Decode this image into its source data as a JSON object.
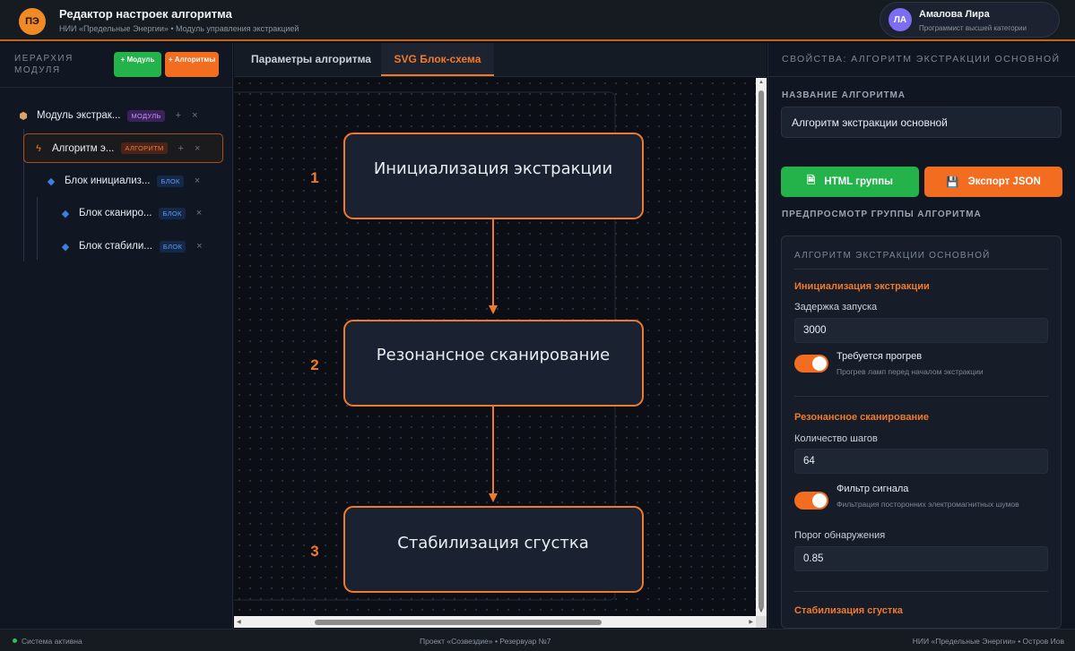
{
  "header": {
    "logo": "ПЭ",
    "title": "Редактор настроек алгоритма",
    "subtitle": "НИИ «Предельные Энергии» • Модуль управления экстракцией",
    "user": {
      "initials": "ЛА",
      "name": "Амалова Лира",
      "role": "Программист высшей категории"
    }
  },
  "hierarchy": {
    "title": "ИЕРАРХИЯ МОДУЛЯ",
    "add_module": "+ Модуль",
    "add_algorithm": "+ Алгоритмы",
    "items": [
      {
        "label": "Модуль экстрак...",
        "tag": "МОДУЛЬ",
        "icon": "cube-icon"
      },
      {
        "label": "Алгоритм э...",
        "tag": "АЛГОРИТМ",
        "icon": "lightning-icon"
      },
      {
        "label": "Блок инициализ...",
        "tag": "БЛОК",
        "icon": "diamond-icon"
      },
      {
        "label": "Блок сканиро...",
        "tag": "БЛОК",
        "icon": "diamond-icon"
      },
      {
        "label": "Блок стабили...",
        "tag": "БЛОК",
        "icon": "diamond-icon"
      }
    ],
    "add_glyph": "+",
    "remove_glyph": "×"
  },
  "tabs": [
    {
      "label": "Параметры алгоритма",
      "active": false
    },
    {
      "label": "SVG Блок-схема",
      "active": true
    }
  ],
  "flowchart": {
    "steps": [
      {
        "number": "1",
        "label": "Инициализация экстракции"
      },
      {
        "number": "2",
        "label": "Резонансное сканирование"
      },
      {
        "number": "3",
        "label": "Стабилизация сгустка"
      }
    ],
    "accent": "#f07a2c"
  },
  "properties": {
    "header": "СВОЙСТВА: АЛГОРИТМ ЭКСТРАКЦИИ ОСНОВНОЙ",
    "name_label": "НАЗВАНИЕ АЛГОРИТМА",
    "name_value": "Алгоритм экстракции основной",
    "html_button": "HTML группы",
    "json_button": "Экспорт JSON",
    "preview_label": "ПРЕДПРОСМОТР ГРУППЫ АЛГОРИТМА",
    "preview": {
      "title": "АЛГОРИТМ ЭКСТРАКЦИИ ОСНОВНОЙ",
      "sections": [
        {
          "title": "Инициализация экстракции",
          "field_label": "Задержка запуска",
          "field_value": "3000",
          "toggle_label": "Требуется прогрев",
          "toggle_desc": "Прогрев ламп перед началом экстракции",
          "toggle_on": true
        },
        {
          "title": "Резонансное сканирование",
          "field_label": "Количество шагов",
          "field_value": "64",
          "toggle_label": "Фильтр сигнала",
          "toggle_desc": "Фильтрация посторонних электромагнитных шумов",
          "toggle_on": true,
          "field2_label": "Порог обнаружения",
          "field2_value": "0.85"
        },
        {
          "title": "Стабилизация сгустка"
        }
      ]
    }
  },
  "footer": {
    "status": "Система активна",
    "project": "Проект «Созвездие» • Резервуар №7",
    "org": "НИИ «Предельные Энергии» • Остров Иов"
  }
}
